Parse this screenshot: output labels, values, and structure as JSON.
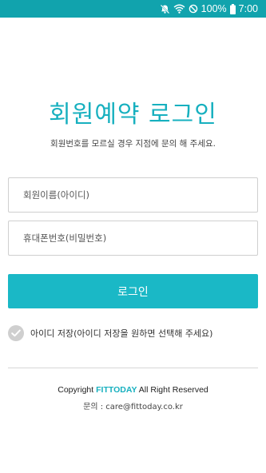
{
  "status_bar": {
    "battery": "100%",
    "time": "7:00",
    "icons": [
      "mute-icon",
      "wifi-icon",
      "blocked-icon",
      "battery-icon"
    ],
    "background": "#11a3ad"
  },
  "header": {
    "title": "회원예약 로그인",
    "subtitle": "회원번호를 모르실 경우 지점에 문의 해 주세요."
  },
  "form": {
    "member_name_placeholder": "회원이름(아이디)",
    "phone_placeholder": "휴대폰번호(비밀번호)",
    "login_label": "로그인",
    "remember_label": "아이디 저장(아이디 저장을 원하면 선택해 주세요)",
    "remember_checked": false
  },
  "footer": {
    "copyright_prefix": "Copyright",
    "brand": "FITTODAY",
    "copyright_suffix": "All Right Reserved",
    "contact": "문의 : care@fittoday.co.kr"
  },
  "colors": {
    "accent": "#17b0bf",
    "button": "#1ab8c6"
  }
}
